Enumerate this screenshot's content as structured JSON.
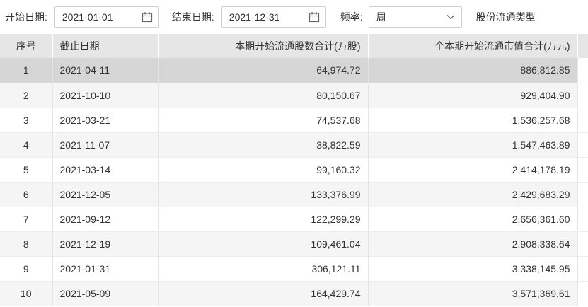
{
  "filters": {
    "start_label": "开始日期:",
    "start_value": "2021-01-01",
    "end_label": "结束日期:",
    "end_value": "2021-12-31",
    "freq_label": "频率:",
    "freq_value": "周",
    "share_type_label": "股份流通类型"
  },
  "table": {
    "headers": {
      "index": "序号",
      "date": "截止日期",
      "shares": "本期开始流通股数合计(万股)",
      "market_value": "个本期开始流通市值合计(万元)"
    },
    "selected_row": 0,
    "rows": [
      {
        "idx": "1",
        "date": "2021-04-11",
        "shares": "64,974.72",
        "value": "886,812.85"
      },
      {
        "idx": "2",
        "date": "2021-10-10",
        "shares": "80,150.67",
        "value": "929,404.90"
      },
      {
        "idx": "3",
        "date": "2021-03-21",
        "shares": "74,537.68",
        "value": "1,536,257.68"
      },
      {
        "idx": "4",
        "date": "2021-11-07",
        "shares": "38,822.59",
        "value": "1,547,463.89"
      },
      {
        "idx": "5",
        "date": "2021-03-14",
        "shares": "99,160.32",
        "value": "2,414,178.19"
      },
      {
        "idx": "6",
        "date": "2021-12-05",
        "shares": "133,376.99",
        "value": "2,429,683.29"
      },
      {
        "idx": "7",
        "date": "2021-09-12",
        "shares": "122,299.29",
        "value": "2,656,361.60"
      },
      {
        "idx": "8",
        "date": "2021-12-19",
        "shares": "109,461.04",
        "value": "2,908,338.64"
      },
      {
        "idx": "9",
        "date": "2021-01-31",
        "shares": "306,121.11",
        "value": "3,338,145.95"
      },
      {
        "idx": "10",
        "date": "2021-05-09",
        "shares": "164,429.74",
        "value": "3,571,369.61"
      }
    ]
  }
}
